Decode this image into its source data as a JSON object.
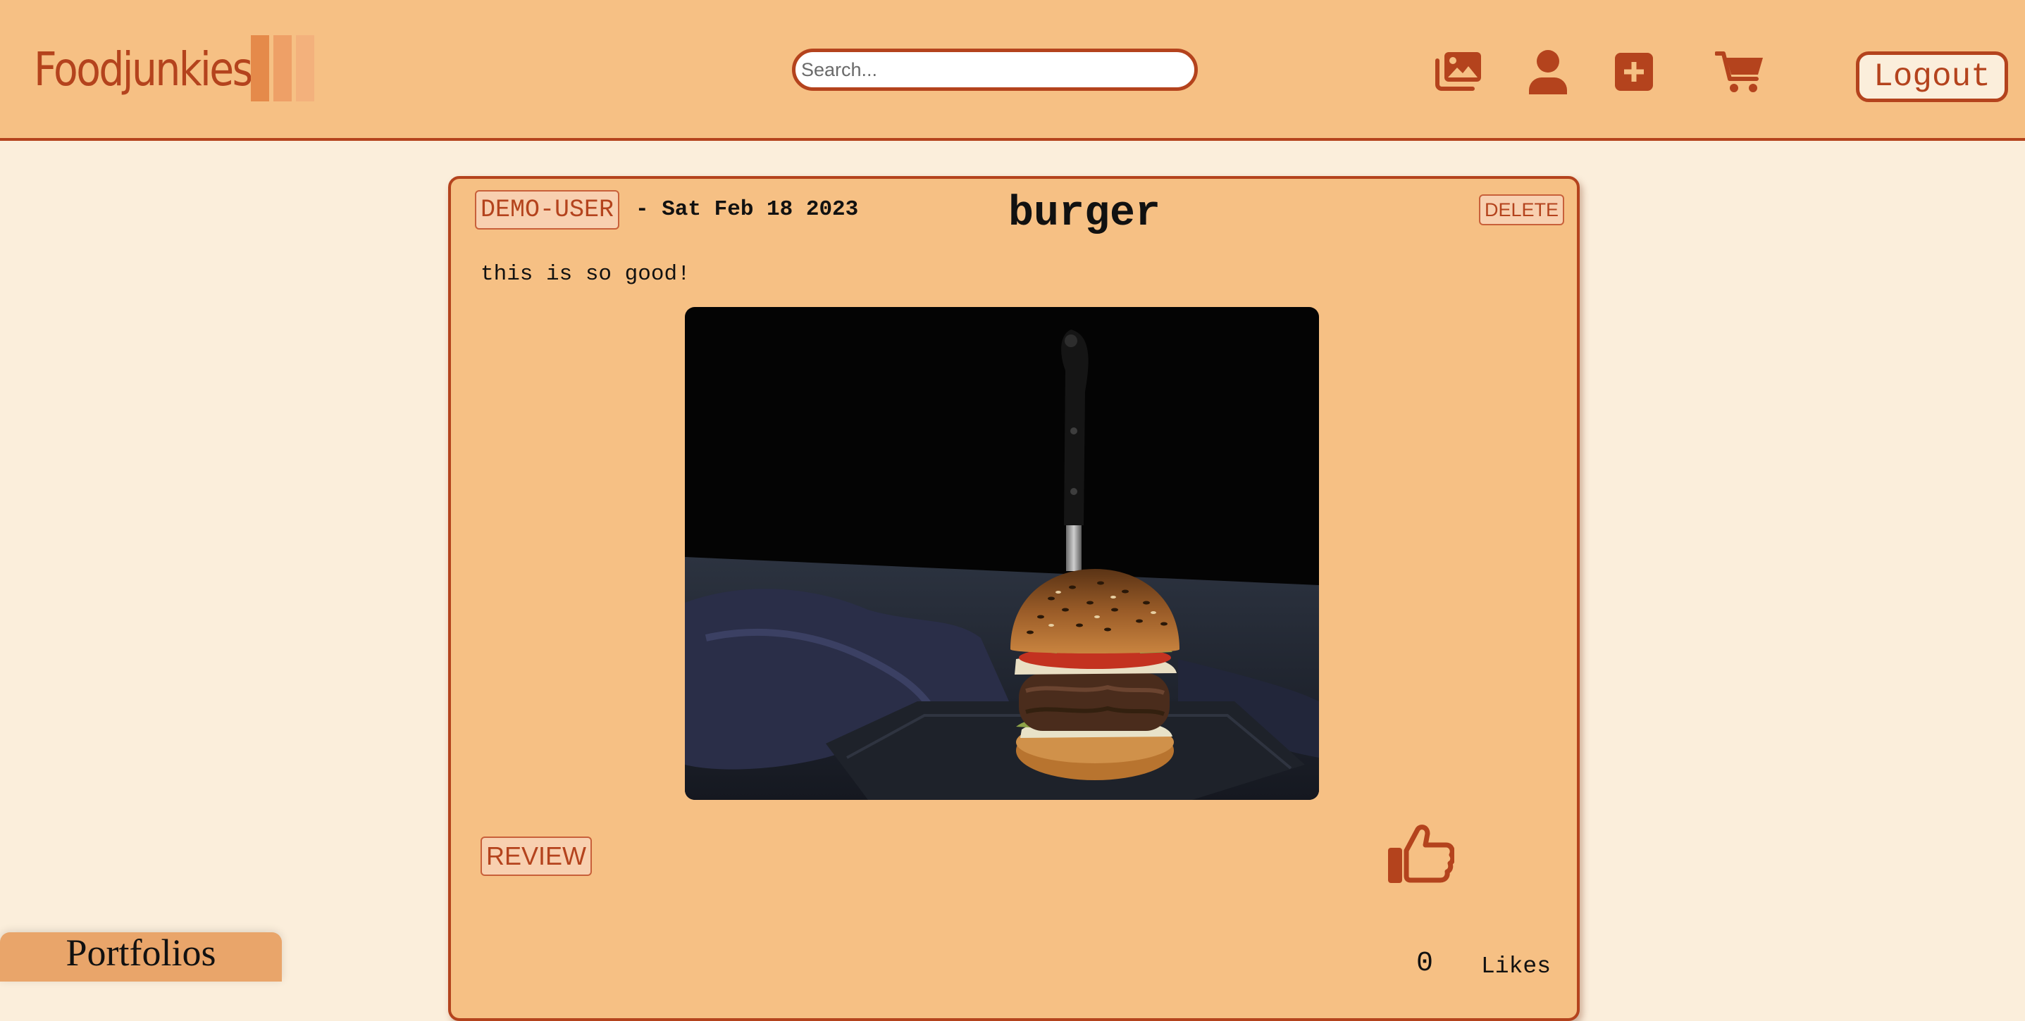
{
  "header": {
    "brand_name": "Foodjunkies",
    "brand_bar_colors": [
      "#e58a4a",
      "#eea067",
      "#f3b17c"
    ],
    "search_placeholder": "Search...",
    "nav_icons": [
      "images-icon",
      "user-icon",
      "plus-square-icon",
      "cart-icon"
    ],
    "logout_label": "Logout"
  },
  "post": {
    "username": "DEMO-USER",
    "date": "- Sat Feb 18 2023",
    "title": "burger",
    "delete_label": "DELETE",
    "body": "this is so good!",
    "image_icon": "burger-photo",
    "review_label": "REVIEW",
    "like_icon": "thumbs-up-icon",
    "likes_count": "0",
    "likes_label": "Likes"
  },
  "footer": {
    "portfolios_label": "Portfolios"
  },
  "colors": {
    "accent": "#b4431d",
    "header_bg": "#f6c084",
    "page_bg": "#fbeedb",
    "card_bg": "#f6c084"
  }
}
